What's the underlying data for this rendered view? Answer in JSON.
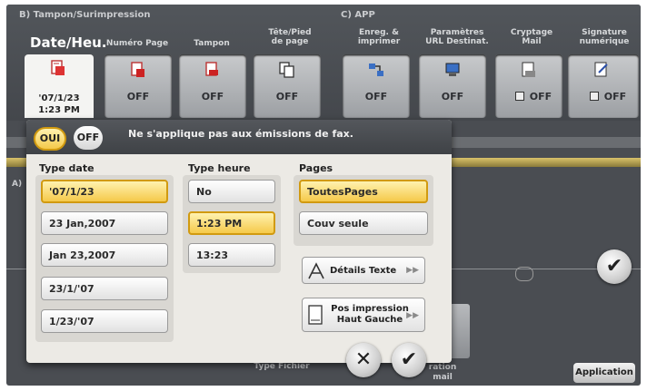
{
  "sections": {
    "left_header": "B)  Tampon/Surimpression",
    "right_header": "C)  APP"
  },
  "columns": {
    "date": "Date/Heu.",
    "page_number": "Numéro Page",
    "stamp": "Tampon",
    "header_footer": "Tête/Pied\nde page",
    "save_print": "Enreg. &\nimprimer",
    "url_params": "Paramètres\nURL Destinat.",
    "mail_encrypt": "Cryptage\nMail",
    "digital_signature": "Signature\nnumérique"
  },
  "tiles": {
    "date_value_line1": "'07/1/23",
    "date_value_line2": "1:23 PM",
    "page_number": "OFF",
    "stamp": "OFF",
    "header_footer": "OFF",
    "save_print": "OFF",
    "url_params": "OFF",
    "mail_encrypt": "OFF",
    "digital_signature": "OFF"
  },
  "background": {
    "file_type": "Type Fichier",
    "mail_partial": "ration\nmail",
    "application_button": "Application",
    "side_letter": "A)"
  },
  "dialog": {
    "toggle_on": "OUI",
    "toggle_off": "OFF",
    "message": "Ne s'applique pas aux émissions de fax.",
    "date_type_title": "Type date",
    "date_types": [
      "'07/1/23",
      "23 Jan,2007",
      "Jan 23,2007",
      "23/1/'07",
      "1/23/'07"
    ],
    "time_type_title": "Type heure",
    "time_types": [
      "No",
      "1:23 PM",
      "13:23"
    ],
    "pages_title": "Pages",
    "pages_options": [
      "ToutesPages",
      "Couv seule"
    ],
    "text_details": "Détails Texte",
    "print_position_line1": "Pos impression",
    "print_position_line2": "Haut Gauche"
  },
  "colors": {
    "selected_fill": "#f5c94a",
    "selected_border": "#d19a10",
    "dialog_bg": "#eceae5",
    "panel_bg": "#4a4d52"
  },
  "icons": [
    "stamp-icon",
    "copy-icon",
    "network-icon",
    "computer-icon",
    "mail-icon",
    "signature-icon",
    "text-details-icon",
    "page-position-icon",
    "cancel-icon",
    "confirm-icon",
    "checkmark-icon"
  ]
}
